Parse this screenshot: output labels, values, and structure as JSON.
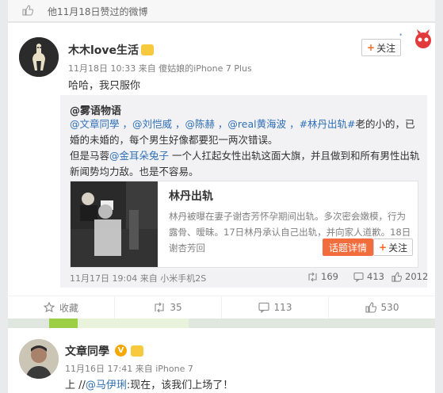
{
  "likes_header": {
    "text": "他11月18日赞过的微博"
  },
  "post1": {
    "author": "木木love生活",
    "time": "11月18日 10:33",
    "source_prefix": "来自",
    "source": "傻姑娘的iPhone 7 Plus",
    "body": "哈哈，我只服你",
    "follow_label": "关注",
    "repost": {
      "author": "@雾语物语",
      "line1_mentions": "@文章同學 ，@刘恺威 ，@陈赫 ，@real黄海波 ，#林丹出轨#",
      "line1_rest": "老的小的，已婚的未婚的，每个男生好像都要犯一两次错误。",
      "line2_prefix": "但是马蓉",
      "line2_mention": "@金耳朵兔子",
      "line2_rest": " 一个人扛起女性出轨这面大旗，并且做到和所有男性出轨新闻势均力敌。也是不容易。",
      "card": {
        "title": "林丹出轨",
        "desc": "林丹被曝在妻子谢杏芳怀孕期间出轨。多次密会嫩模，行为露骨、暧昧。17日林丹承认自己出轨，并向家人道歉。18日谢杏芳回",
        "topic_button": "话题详情",
        "follow_label": "关注"
      },
      "time": "11月17日 19:04",
      "source_prefix": "来自",
      "source": "小米手机2S",
      "reposts": "169",
      "comments": "413",
      "likes": "2012"
    },
    "actions": {
      "favorite": "收藏",
      "repost": "35",
      "comment": "113",
      "like": "530"
    }
  },
  "post2": {
    "author": "文章同學",
    "time": "11月16日 17:41",
    "source_prefix": "来自",
    "source": "iPhone 7",
    "body_prefix": "上 //",
    "body_mention": "@马伊琍",
    "body_rest": ":现在，该我们上场了！"
  },
  "colors": {
    "accent": "#eb7350",
    "link": "#2f6fb6",
    "topic_button": "#f26d3d"
  }
}
